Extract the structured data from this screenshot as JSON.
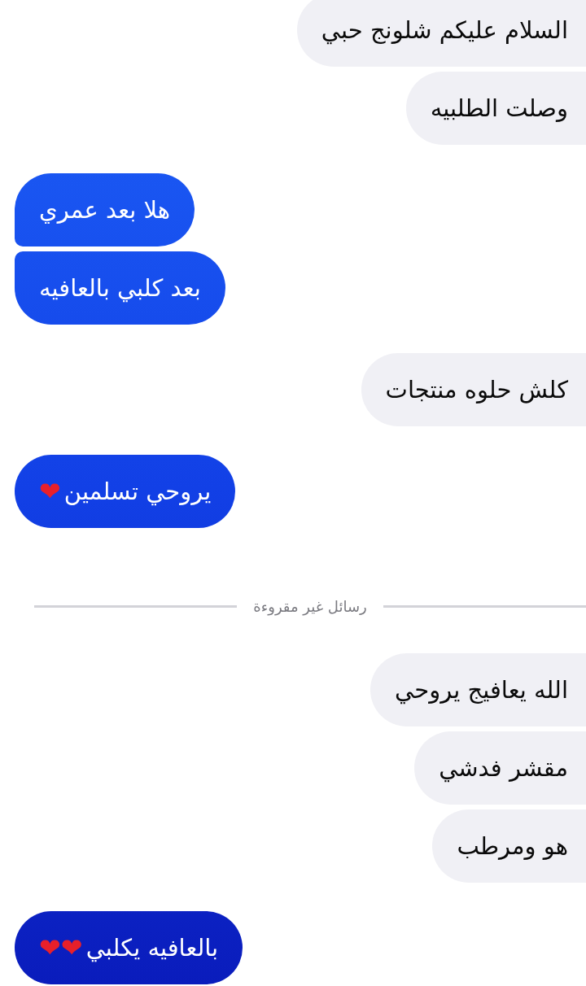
{
  "messages": [
    {
      "kind": "incoming",
      "text": "السلام عليكم شلونج حبي"
    },
    {
      "kind": "incoming",
      "text": "وصلت الطلبيه"
    },
    {
      "kind": "outgoing",
      "text": "هلا بعد عمري"
    },
    {
      "kind": "outgoing",
      "text": "بعد كلبي بالعافيه"
    },
    {
      "kind": "incoming",
      "text": "كلش حلوه منتجات"
    },
    {
      "kind": "outgoing",
      "text": "يروحي تسلمين",
      "emoji": "❤"
    },
    {
      "kind": "divider",
      "text": "رسائل غير مقروءة"
    },
    {
      "kind": "incoming",
      "text": "الله يعافيج يروحي"
    },
    {
      "kind": "incoming",
      "text": "مقشر فدشي"
    },
    {
      "kind": "incoming",
      "text": "هو ومرطب"
    },
    {
      "kind": "outgoing",
      "text": "بالعافيه يكلبي",
      "emoji": "❤❤"
    }
  ]
}
